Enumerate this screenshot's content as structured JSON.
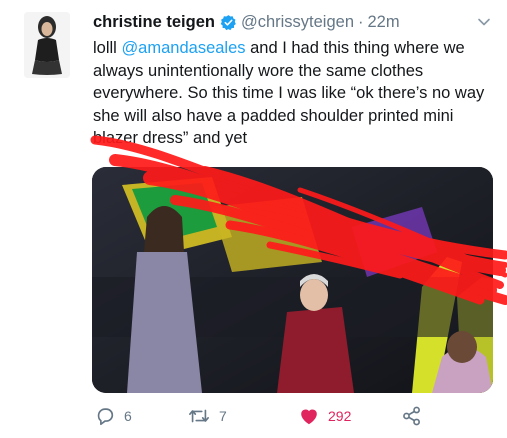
{
  "tweet": {
    "display_name": "christine teigen",
    "handle": "@chrissyteigen",
    "separator": "·",
    "time": "22m",
    "text_prefix": "lolll ",
    "mention": "@amandaseales",
    "text_body": " and I had this thing where we always unintentionally wore the same clothes everywhere. So this time I was like “ok there’s no way she will also have a padded shoulder printed mini blazer dress” and yet"
  },
  "actions": {
    "reply_count": "6",
    "retweet_count": "7",
    "like_count": "292"
  },
  "colors": {
    "link": "#1da1f2",
    "like": "#e0245e",
    "muted": "#657786",
    "verified": "#1da1f2",
    "scribble": "#ff1a1a"
  },
  "icons": {
    "verified": "verified-badge-icon",
    "caret": "chevron-down-icon",
    "reply": "reply-icon",
    "retweet": "retweet-icon",
    "like": "heart-icon",
    "share": "share-icon"
  }
}
